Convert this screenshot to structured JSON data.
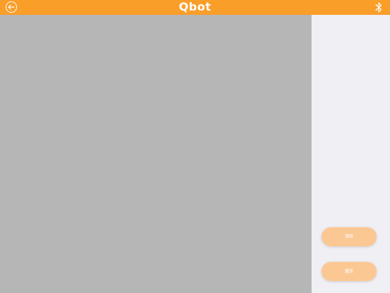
{
  "header": {
    "brand": "Qbot",
    "back_icon": "back-arrow-icon",
    "bluetooth_icon": "bluetooth-icon",
    "background_color": "#fa9e2a"
  },
  "workspace": {
    "background_color": "#b6b6b6"
  },
  "side_panel": {
    "background_color": "#efeff4",
    "buttons": [
      {
        "label": "清除"
      },
      {
        "label": "播放"
      }
    ],
    "button_color": "#fbc894"
  }
}
